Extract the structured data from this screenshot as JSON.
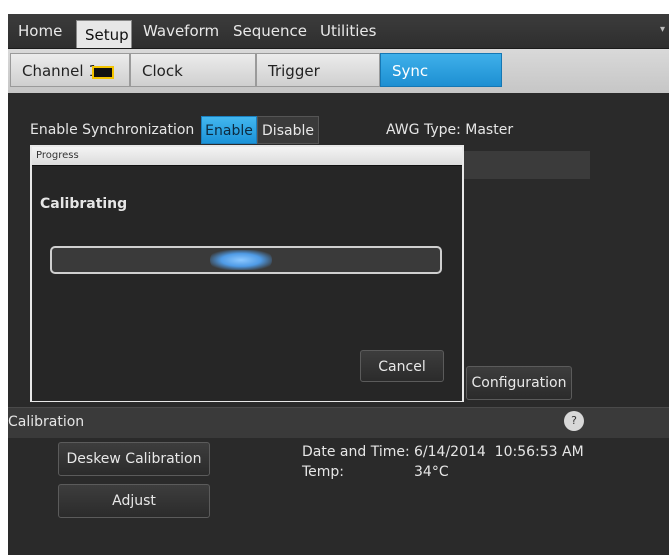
{
  "menu": {
    "items": [
      "Home",
      "Setup",
      "Waveform",
      "Sequence",
      "Utilities"
    ],
    "active": "Setup"
  },
  "subtabs": {
    "channel": "Channel 1",
    "clock": "Clock",
    "trigger": "Trigger",
    "sync": "Sync",
    "channel_color": "#f3c400"
  },
  "sync": {
    "enable_label": "Enable Synchronization",
    "enable_btn": "Enable",
    "disable_btn": "Disable",
    "awg_type": "AWG Type: Master",
    "configuration_btn": "Configuration"
  },
  "calibration": {
    "header": "Calibration",
    "help": "?",
    "deskew_btn": "Deskew Calibration",
    "adjust_btn": "Adjust",
    "date_label": "Date and Time:",
    "date_value": "6/14/2014  10:56:53 AM",
    "temp_label": "Temp:",
    "temp_value": "34°C"
  },
  "dialog": {
    "title": "Progress",
    "message": "Calibrating",
    "cancel": "Cancel"
  }
}
